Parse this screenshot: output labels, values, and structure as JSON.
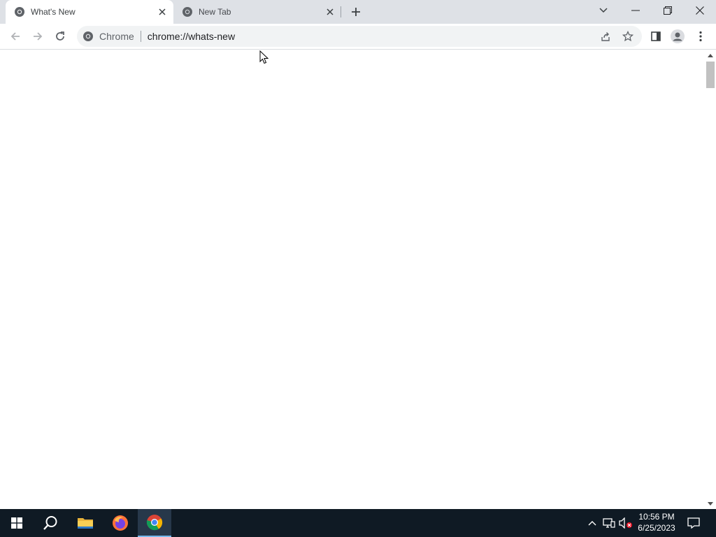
{
  "browser": {
    "tabs": [
      {
        "title": "What's New",
        "active": true
      },
      {
        "title": "New Tab",
        "active": false
      }
    ],
    "omnibox": {
      "chip_label": "Chrome",
      "url": "chrome://whats-new"
    }
  },
  "taskbar": {
    "apps": [
      "start-icon",
      "search-icon",
      "file-explorer-icon",
      "firefox-icon",
      "chrome-icon"
    ],
    "clock": {
      "time": "10:56 PM",
      "date": "6/25/2023"
    }
  },
  "colors": {
    "tabstrip_bg": "#dee1e6",
    "omnibox_bg": "#f1f3f4",
    "taskbar_bg": "#0f1a24"
  }
}
